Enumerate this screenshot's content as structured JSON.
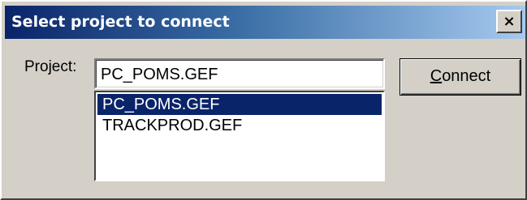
{
  "window": {
    "title": "Select project to connect",
    "close_glyph": "×"
  },
  "form": {
    "project_label": "Project:",
    "project_value": "PC_POMS.GEF"
  },
  "list": {
    "items": [
      {
        "label": "PC_POMS.GEF",
        "selected": true
      },
      {
        "label": "TRACKPROD.GEF",
        "selected": false
      }
    ]
  },
  "buttons": {
    "connect_label": "Connect"
  },
  "colors": {
    "titlebar_start": "#0a246a",
    "titlebar_end": "#a6caf0",
    "selection": "#0a246a",
    "dialog_bg": "#d4d0c8"
  },
  "icons": {
    "close": "close-icon"
  }
}
